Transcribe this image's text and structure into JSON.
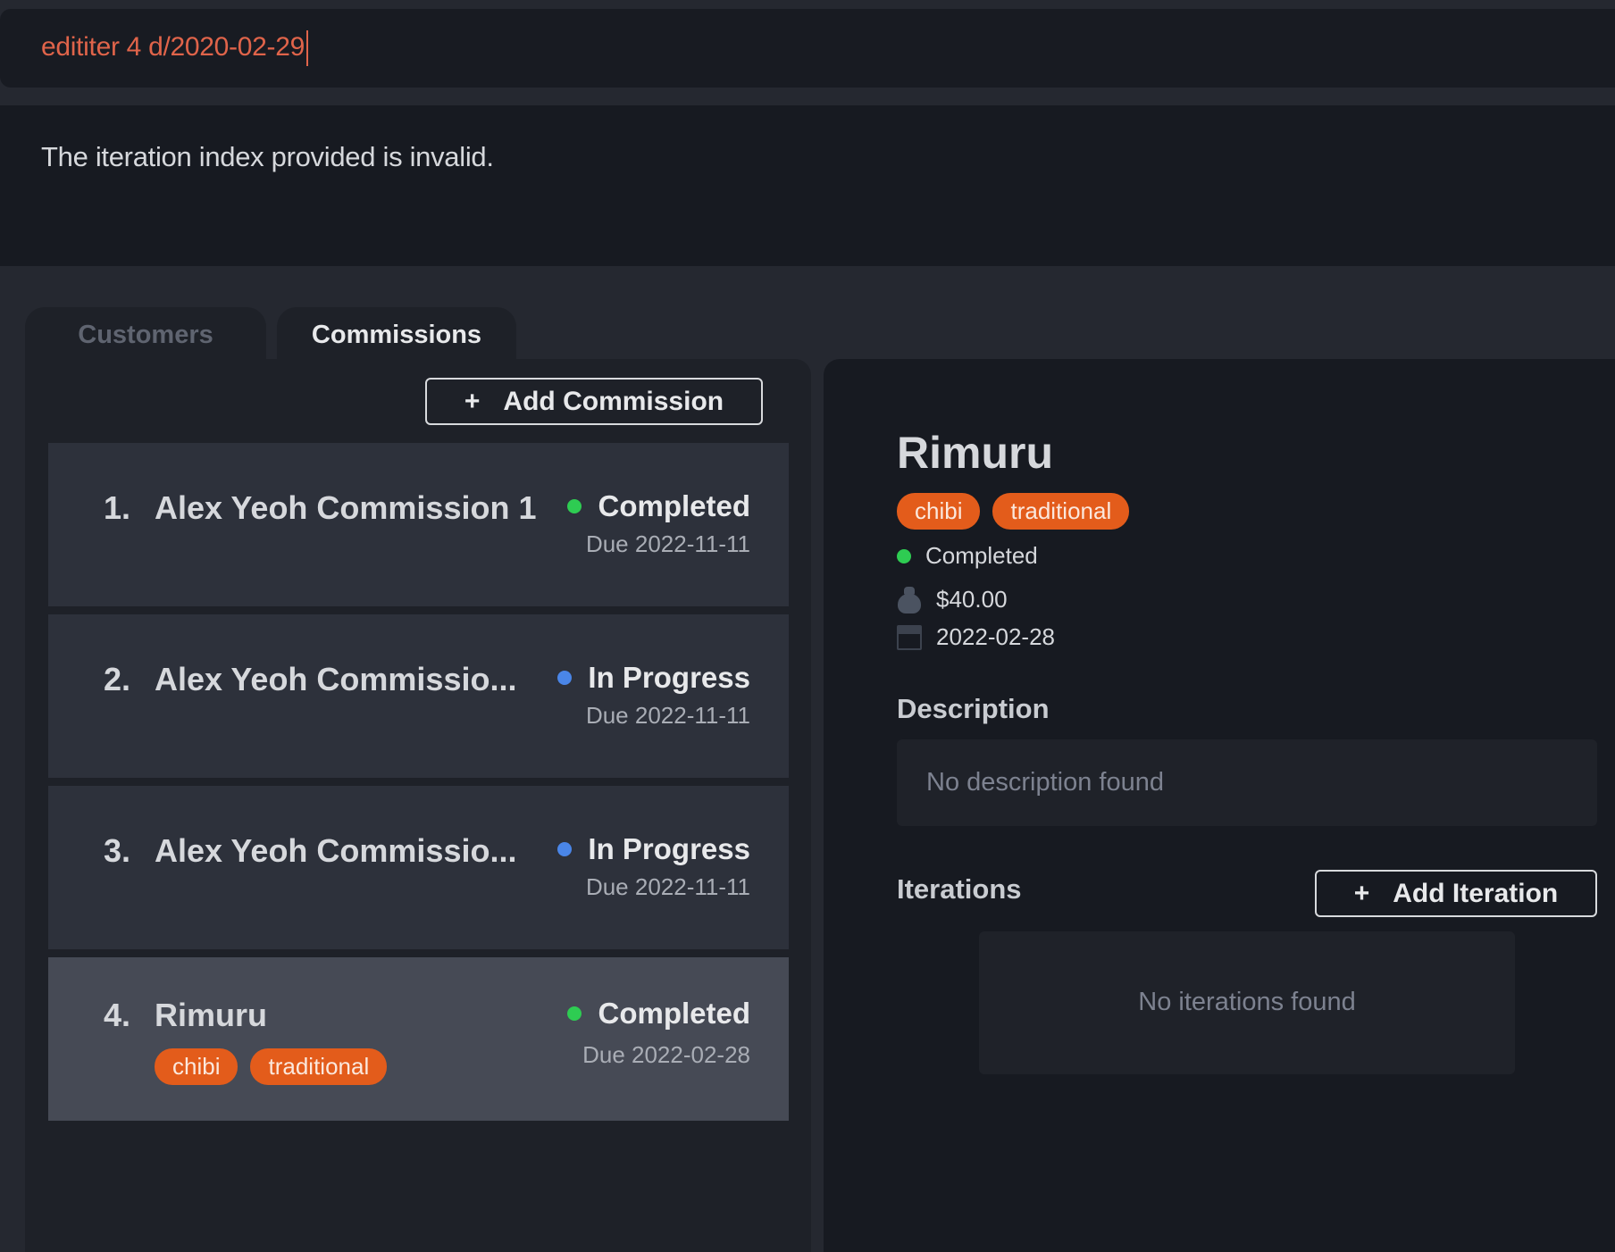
{
  "command": {
    "value": "edititer 4 d/2020-02-29"
  },
  "result": {
    "message": "The iteration index provided is invalid."
  },
  "tabs": [
    {
      "label": "Customers",
      "active": false
    },
    {
      "label": "Commissions",
      "active": true
    }
  ],
  "commission_list": {
    "add_button_label": "Add Commission",
    "add_button_icon": "plus-icon",
    "items": [
      {
        "index": "1.",
        "title": "Alex Yeoh Commission 1",
        "status": "Completed",
        "status_color": "#2ecc52",
        "due": "Due 2022-11-11",
        "tags": []
      },
      {
        "index": "2.",
        "title": "Alex Yeoh Commissio...",
        "status": "In Progress",
        "status_color": "#4a86e8",
        "due": "Due 2022-11-11",
        "tags": []
      },
      {
        "index": "3.",
        "title": "Alex Yeoh Commissio...",
        "status": "In Progress",
        "status_color": "#4a86e8",
        "due": "Due 2022-11-11",
        "tags": []
      },
      {
        "index": "4.",
        "title": "Rimuru",
        "status": "Completed",
        "status_color": "#2ecc52",
        "due": "Due 2022-02-28",
        "tags": [
          "chibi",
          "traditional"
        ],
        "selected": true
      }
    ]
  },
  "detail": {
    "title": "Rimuru",
    "tags": [
      "chibi",
      "traditional"
    ],
    "status": "Completed",
    "price": "$40.00",
    "price_icon": "money-bag-icon",
    "deadline": "2022-02-28",
    "deadline_icon": "calendar-icon",
    "description_heading": "Description",
    "description_text": "No description found",
    "iterations_heading": "Iterations",
    "add_iteration_label": "Add Iteration",
    "iterations_empty_text": "No iterations found"
  },
  "colors": {
    "tag_bg": "#e35c1b",
    "command_text": "#e0644a",
    "completed": "#2ecc52",
    "in_progress": "#4a86e8"
  }
}
